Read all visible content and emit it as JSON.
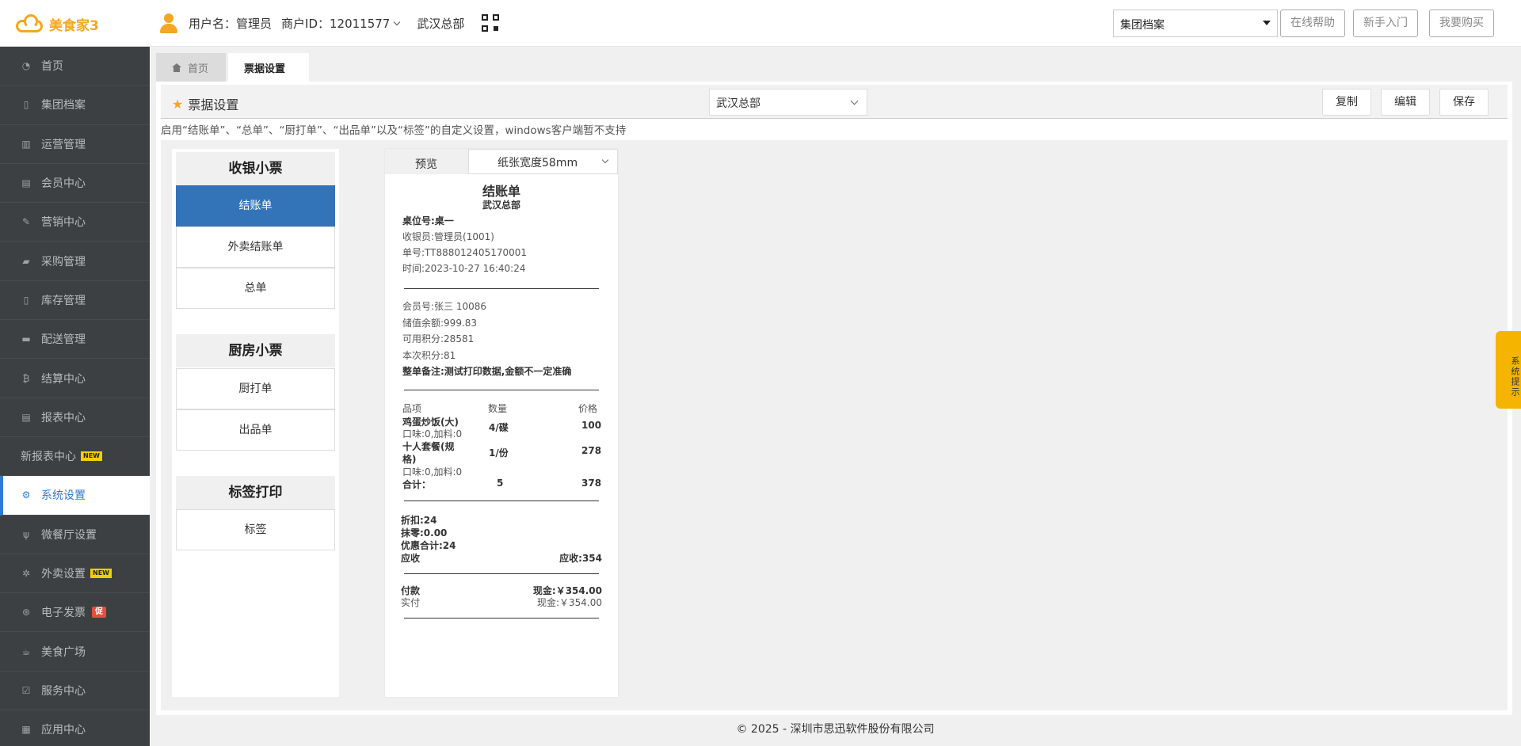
{
  "app": {
    "brand": "美食家3"
  },
  "header": {
    "user_label": "用户名：管理员",
    "merchant_label": "商户ID：12011577",
    "store": "武汉总部",
    "group_select": "集团档案",
    "btn_help": "在线帮助",
    "btn_newbie": "新手入门",
    "btn_buy": "我要购买"
  },
  "sidebar": {
    "items": [
      {
        "label": "首页",
        "icon": "gauge-icon"
      },
      {
        "label": "集团档案",
        "icon": "file-icon"
      },
      {
        "label": "运营管理",
        "icon": "bar-chart-icon"
      },
      {
        "label": "会员中心",
        "icon": "id-card-icon"
      },
      {
        "label": "营销中心",
        "icon": "edit-icon"
      },
      {
        "label": "采购管理",
        "icon": "book-icon"
      },
      {
        "label": "库存管理",
        "icon": "tablet-icon"
      },
      {
        "label": "配送管理",
        "icon": "truck-icon"
      },
      {
        "label": "结算中心",
        "icon": "bitcoin-icon"
      },
      {
        "label": "报表中心",
        "icon": "report-icon"
      },
      {
        "label": "新报表中心",
        "badge": "NEW"
      },
      {
        "label": "系统设置",
        "icon": "gears-icon"
      },
      {
        "label": "微餐厅设置",
        "icon": "cutlery-icon"
      },
      {
        "label": "外卖设置",
        "icon": "gear-icon",
        "badge": "NEW"
      },
      {
        "label": "电子发票",
        "icon": "circle-icon",
        "badge": "促"
      },
      {
        "label": "美食广场",
        "icon": "coffee-icon"
      },
      {
        "label": "服务中心",
        "icon": "check-square-icon"
      },
      {
        "label": "应用中心",
        "icon": "grid-icon"
      }
    ]
  },
  "tabs": {
    "home": "首页",
    "current": "票据设置"
  },
  "panel": {
    "title": "票据设置",
    "store_select": "武汉总部",
    "btn_copy": "复制",
    "btn_edit": "编辑",
    "btn_save": "保存",
    "notice": "启用“结账单”、“总单”、“厨打单”、“出品单”以及“标签”的自定义设置，windows客户端暂不支持"
  },
  "templates": {
    "cat_cashier": "收银小票",
    "checkout": "结账单",
    "takeout_checkout": "外卖结账单",
    "summary": "总单",
    "cat_kitchen": "厨房小票",
    "kitchen_print": "厨打单",
    "dish_out": "出品单",
    "cat_label": "标签打印",
    "label": "标签"
  },
  "preview": {
    "label": "预览",
    "paper": "纸张宽度58mm",
    "title": "结账单",
    "store": "武汉总部",
    "table": "桌位号:桌一",
    "cashier": "收银员:管理员(1001)",
    "order_no": "单号:TT888012405170001",
    "time": "时间:2023-10-27 16:40:24",
    "member": "会员号:张三 10086",
    "balance": "储值余额:999.83",
    "points_avail": "可用积分:28581",
    "points_now": "本次积分:81",
    "remark": "整单备注:测试打印数据,金额不一定准确",
    "col_item": "品项",
    "col_qty": "数量",
    "col_price": "价格",
    "item1_name": "鸡蛋炒饭(大)",
    "item1_sub": "口味:0,加料:0",
    "item1_qty": "4/碟",
    "item1_price": "100",
    "item2_name_1": "十人套餐(规",
    "item2_name_2": "格)",
    "item2_sub": "口味:0,加料:0",
    "item2_qty": "1/份",
    "item2_price": "278",
    "total_label": "合计：",
    "total_qty": "5",
    "total_price": "378",
    "discount": "折扣:24",
    "round": "抹零:0.00",
    "promo": "优惠合计:24",
    "receivable_label": "应收",
    "receivable_value": "应收:354",
    "pay_label": "付款",
    "pay_value": "现金:￥354.00",
    "paid_label": "实付",
    "paid_value": "现金:￥354.00"
  },
  "footer": "© 2025 - 深圳市思迅软件股份有限公司",
  "float_tab": "系统提示"
}
